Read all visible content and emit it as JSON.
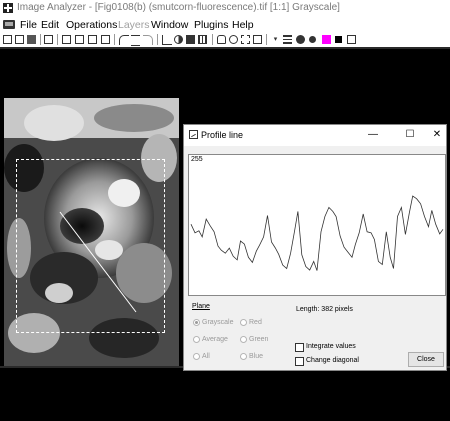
{
  "window": {
    "title": "Image Analyzer - [Fig0108(b) (smutcorn-fluorescence).tif [1:1] Grayscale]",
    "app_icon": "plus-app-icon"
  },
  "menu": {
    "icon": "document-menu-icon",
    "items": [
      {
        "label": "File",
        "enabled": true
      },
      {
        "label": "Edit",
        "enabled": true
      },
      {
        "label": "Operations",
        "enabled": true
      },
      {
        "label": "Layers",
        "enabled": false
      },
      {
        "label": "Window",
        "enabled": true
      },
      {
        "label": "Plugins",
        "enabled": true
      },
      {
        "label": "Help",
        "enabled": true
      }
    ]
  },
  "toolbar": {
    "icons": [
      "new-icon",
      "open-icon",
      "save-icon",
      "print-icon",
      "copy-icon",
      "paste-icon",
      "cut-icon",
      "undo-icon",
      "redo-icon",
      "crop-icon",
      "line-icon",
      "contrast-icon",
      "brightness-icon",
      "grid-icon",
      "hand-icon",
      "zoom-icon",
      "select-icon",
      "lasso-icon",
      "dropdown-icon",
      "pen-width-icon",
      "brush-icon",
      "spray-icon",
      "fg-color-icon",
      "bg-color-icon",
      "white-color-icon"
    ],
    "colors": {
      "foreground": "#ff00ff",
      "background": "#000000",
      "third": "#ffffff"
    }
  },
  "profile_window": {
    "title": "Profile line",
    "icon": "chart-line-icon",
    "buttons": {
      "minimize": "—",
      "maximize": "☐",
      "close": "✕"
    },
    "plot": {
      "y_max_label": "255"
    },
    "plane_label": "Plane",
    "planes": [
      {
        "label": "Grayscale",
        "checked": true
      },
      {
        "label": "Red",
        "checked": false
      },
      {
        "label": "Average",
        "checked": false
      },
      {
        "label": "Green",
        "checked": false
      },
      {
        "label": "All",
        "checked": false
      },
      {
        "label": "Blue",
        "checked": false
      }
    ],
    "length_text": "Length: 382 pixels",
    "integrate_values_label": "Integrate values",
    "integrate_values_checked": false,
    "change_diagonal_label": "Change diagonal",
    "change_diagonal_checked": false,
    "close_label": "Close"
  },
  "chart_data": {
    "type": "line",
    "title": "",
    "xlabel": "",
    "ylabel": "",
    "ylim": [
      0,
      255
    ],
    "xlim": [
      0,
      382
    ],
    "series": [
      {
        "x": [
          0,
          6,
          12,
          17,
          23,
          29,
          35,
          41,
          46,
          52,
          58,
          64,
          70,
          75,
          81,
          87,
          93,
          99,
          104,
          110,
          116,
          122,
          128,
          133,
          139,
          145,
          151,
          157,
          162,
          168,
          174,
          180,
          186,
          191,
          197,
          203,
          209,
          215,
          220,
          226,
          232,
          238,
          244,
          249,
          255,
          261,
          267,
          273,
          278,
          284,
          290,
          296,
          302,
          307,
          313,
          319,
          325,
          331,
          336,
          342,
          348,
          354,
          360,
          365,
          371,
          377,
          382
        ],
        "y": [
          135,
          118,
          122,
          110,
          145,
          132,
          120,
          92,
          84,
          78,
          88,
          72,
          65,
          102,
          96,
          70,
          60,
          82,
          94,
          110,
          152,
          100,
          88,
          76,
          55,
          48,
          78,
          122,
          160,
          75,
          52,
          45,
          62,
          44,
          120,
          150,
          168,
          160,
          150,
          112,
          90,
          80,
          70,
          95,
          118,
          155,
          120,
          118,
          105,
          62,
          56,
          120,
          70,
          48,
          150,
          168,
          115,
          158,
          190,
          185,
          175,
          150,
          130,
          162,
          135,
          116,
          125
        ]
      }
    ],
    "grid": false,
    "legend": "none"
  }
}
